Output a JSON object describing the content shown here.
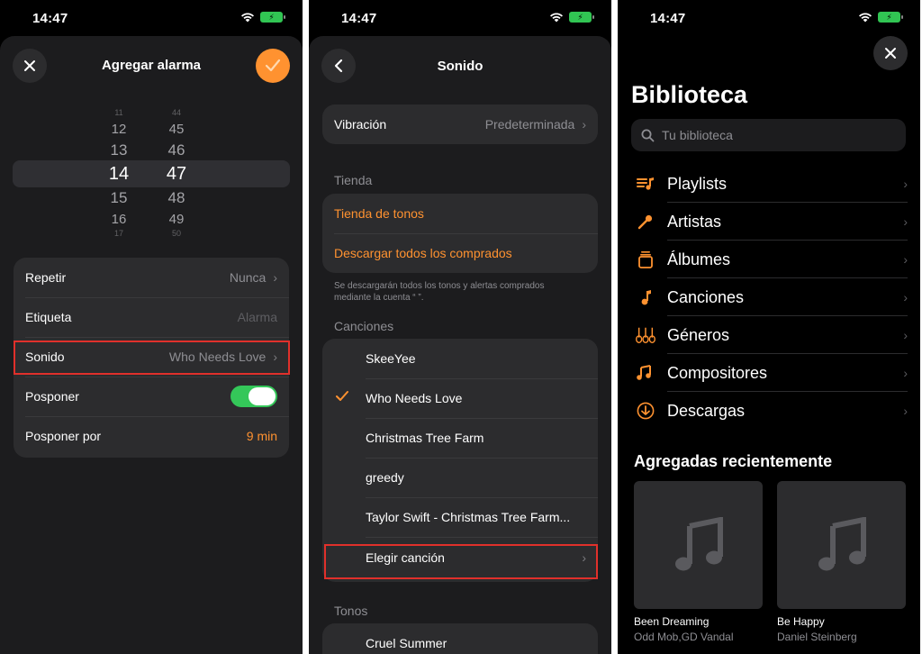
{
  "status": {
    "time": "14:47"
  },
  "screen1": {
    "title": "Agregar alarma",
    "picker": {
      "hours": [
        "12",
        "13",
        "14",
        "15",
        "16"
      ],
      "minutes": [
        "45",
        "46",
        "47",
        "48",
        "49"
      ]
    },
    "rows": {
      "repeat_label": "Repetir",
      "repeat_value": "Nunca",
      "label_label": "Etiqueta",
      "label_placeholder": "Alarma",
      "sound_label": "Sonido",
      "sound_value": "Who Needs Love",
      "snooze_label": "Posponer",
      "snooze_for_label": "Posponer por",
      "snooze_for_value": "9 min"
    }
  },
  "screen2": {
    "title": "Sonido",
    "vibration_label": "Vibración",
    "vibration_value": "Predeterminada",
    "store_header": "Tienda",
    "tone_store": "Tienda de tonos",
    "download_all": "Descargar todos los comprados",
    "note_line1": "Se descargarán todos los tonos y alertas comprados",
    "note_line2": "mediante la cuenta “                              ”.",
    "songs_header": "Canciones",
    "songs": [
      "SkeeYee",
      "Who Needs Love",
      "Christmas Tree Farm",
      "greedy",
      "Taylor Swift - Christmas Tree Farm..."
    ],
    "selected_index": 1,
    "choose_song": "Elegir canción",
    "tones_header": "Tonos",
    "tones": [
      "Cruel Summer"
    ]
  },
  "screen3": {
    "title": "Biblioteca",
    "search_placeholder": "Tu biblioteca",
    "items": [
      "Playlists",
      "Artistas",
      "Álbumes",
      "Canciones",
      "Géneros",
      "Compositores",
      "Descargas"
    ],
    "recent_header": "Agregadas recientemente",
    "albums": [
      {
        "title": "Been Dreaming",
        "artist": "Odd Mob,GD Vandal"
      },
      {
        "title": "Be Happy",
        "artist": "Daniel Steinberg"
      }
    ]
  },
  "colors": {
    "accent": "#ff9230",
    "toggle_on": "#34c759",
    "highlight": "#e0302b"
  }
}
